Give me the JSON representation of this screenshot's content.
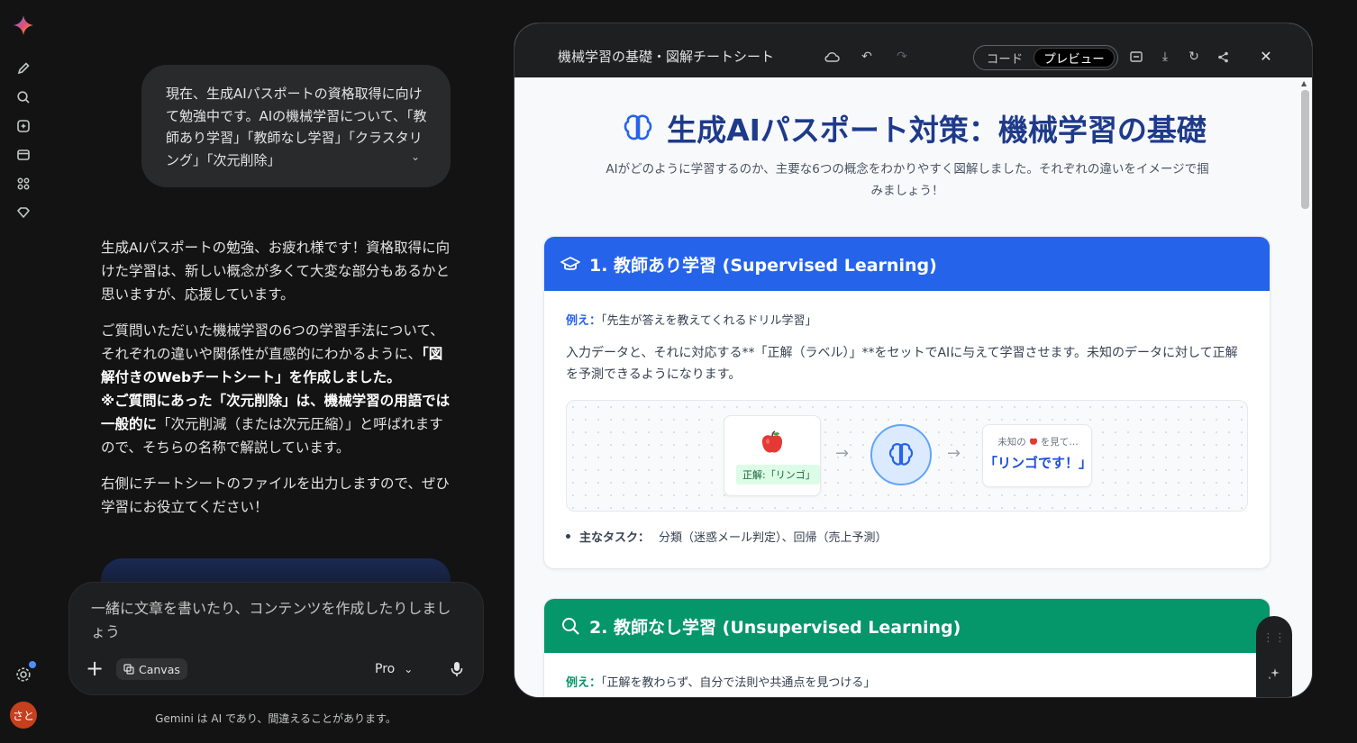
{
  "rail": {
    "icons": [
      "gemini-logo",
      "new-chat-icon",
      "search-icon",
      "gem-icon",
      "library-icon",
      "apps-icon",
      "heart-icon",
      "settings-icon"
    ],
    "avatar_text": "さと"
  },
  "chat": {
    "user_message": "現在、生成AIパスポートの資格取得に向けて勉強中です。AIの機械学習について、「教師あり学習」「教師なし学習」「クラスタリング」「次元削除」",
    "response": {
      "p1": "生成AIパスポートの勉強、お疲れ様です！資格取得に向けた学習は、新しい概念が多くて大変な部分もあるかと思いますが、応援しています。",
      "p2_a": "ご質問いただいた機械学習の6つの学習手法について、それぞれの違いや関係性が直感的にわかるように、",
      "p2_b": "「図解付きのWebチートシート」を作成しました。",
      "p2_c": "※ご質問にあった「次元削除」は、機械学習の用語では一般的に",
      "p2_d": "「次元削減（または次元圧縮）」と呼ばれますので、そちらの名称で解説しています。",
      "p3": "右側にチートシートのファイルを出力しますので、ぜひ学習にお役立てください！"
    },
    "composer": {
      "placeholder": "一緒に文章を書いたり、コンテンツを作成したりしましょう",
      "canvas_label": "Canvas",
      "model_label": "Pro"
    },
    "disclaimer": "Gemini は AI であり、間違えることがあります。"
  },
  "panel": {
    "title": "機械学習の基礎・図解チートシート",
    "toggle_code": "コード",
    "toggle_preview": "プレビュー"
  },
  "doc": {
    "title": "生成AIパスポート対策：機械学習の基礎",
    "subtitle": "AIがどのように学習するのか、主要な6つの概念をわかりやすく図解しました。それぞれの違いをイメージで掴みましょう！",
    "sections": [
      {
        "heading": "1. 教師あり学習 (Supervised Learning)",
        "example_label": "例え：",
        "example_text": "「先生が答えを教えてくれるドリル学習」",
        "description": "入力データと、それに対応する**「正解（ラベル）」**をセットでAIに与えて学習させます。未知のデータに対して正解を予測できるようになります。",
        "diagram": {
          "input_label": "正解:「リンゴ」",
          "output_small_a": "未知の",
          "output_small_b": "を見て…",
          "output_big": "「リンゴです！」"
        },
        "task_label": "主なタスク：",
        "task_text": "分類（迷惑メール判定）、回帰（売上予測）",
        "color": "#2563eb"
      },
      {
        "heading": "2. 教師なし学習 (Unsupervised Learning)",
        "example_label": "例え：",
        "example_text": "「正解を教わらず、自分で法則や共通点を見つける」",
        "color": "#059669"
      }
    ]
  }
}
